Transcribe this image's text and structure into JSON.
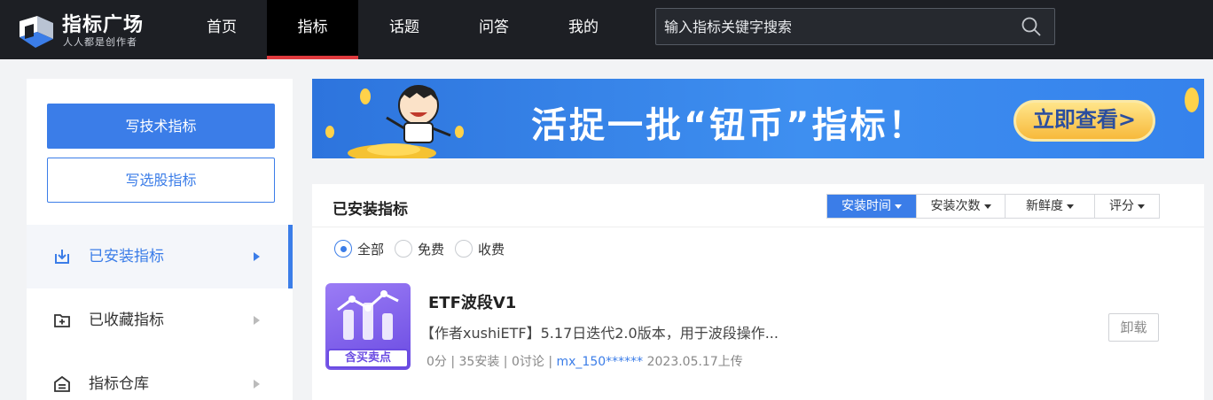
{
  "brand": {
    "title": "指标广场",
    "subtitle": "人人都是创作者"
  },
  "nav": {
    "items": [
      {
        "label": "首页"
      },
      {
        "label": "指标",
        "active": true
      },
      {
        "label": "话题"
      },
      {
        "label": "问答"
      },
      {
        "label": "我的"
      }
    ]
  },
  "search": {
    "placeholder": "输入指标关键字搜索",
    "value": ""
  },
  "sidebar": {
    "write_tech": "写技术指标",
    "write_stock": "写选股指标",
    "items": [
      {
        "label": "已安装指标",
        "icon": "download-box-icon",
        "active": true
      },
      {
        "label": "已收藏指标",
        "icon": "folder-plus-icon"
      },
      {
        "label": "指标仓库",
        "icon": "warehouse-icon"
      }
    ]
  },
  "banner": {
    "headline": "活捉一批“钮币”指标！",
    "cta": "立即查看>"
  },
  "panel": {
    "title": "已安装指标",
    "sort_options": [
      {
        "label": "安装时间",
        "active": true
      },
      {
        "label": "安装次数"
      },
      {
        "label": "新鲜度"
      },
      {
        "label": "评分"
      }
    ],
    "filters": [
      {
        "label": "全部",
        "checked": true
      },
      {
        "label": "免费"
      },
      {
        "label": "收费"
      }
    ],
    "items": [
      {
        "thumb_tag": "含买卖点",
        "title": "ETF波段V1",
        "description": "【作者xushiETF】5.17日迭代2.0版本，用于波段操作...",
        "meta_prefix": "0分 | 35安装 | 0讨论 | ",
        "author": "mx_150******",
        "meta_suffix": " 2023.05.17上传",
        "action": "卸载"
      }
    ]
  },
  "colors": {
    "topbar": "#1d1f24",
    "accent": "#3b7de8",
    "nav_active_underline": "#e03a3e",
    "thumb": "#6a4be2"
  }
}
